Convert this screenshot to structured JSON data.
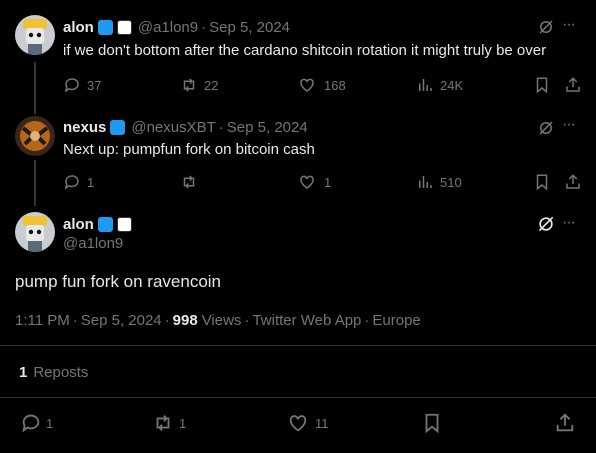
{
  "tweets": [
    {
      "display_name": "alon",
      "handle": "@a1lon9",
      "date": "Sep 5, 2024",
      "text": "if we don't bottom after the cardano shitcoin rotation it might truly be over",
      "replies": "37",
      "reposts": "22",
      "likes": "168",
      "views": "24K"
    },
    {
      "display_name": "nexus",
      "handle": "@nexusXBT",
      "date": "Sep 5, 2024",
      "text": "Next up: pumpfun fork on bitcoin cash",
      "replies": "1",
      "reposts": "",
      "likes": "1",
      "views": "510"
    }
  ],
  "main_tweet": {
    "display_name": "alon",
    "handle": "@a1lon9",
    "text": "pump fun fork on ravencoin",
    "time": "1:11 PM",
    "date": "Sep 5, 2024",
    "views_count": "998",
    "views_label": "Views",
    "source": "Twitter Web App",
    "location": "Europe",
    "reposts_count": "1",
    "reposts_label": "Reposts",
    "replies": "1",
    "reposts": "1",
    "likes": "11"
  },
  "separator": "·",
  "more_glyph": "···",
  "colors": {
    "background": "#000000",
    "text": "#e7e9ea",
    "muted": "#71767b",
    "verified": "#1d9bf0",
    "divider": "#2f3336"
  }
}
